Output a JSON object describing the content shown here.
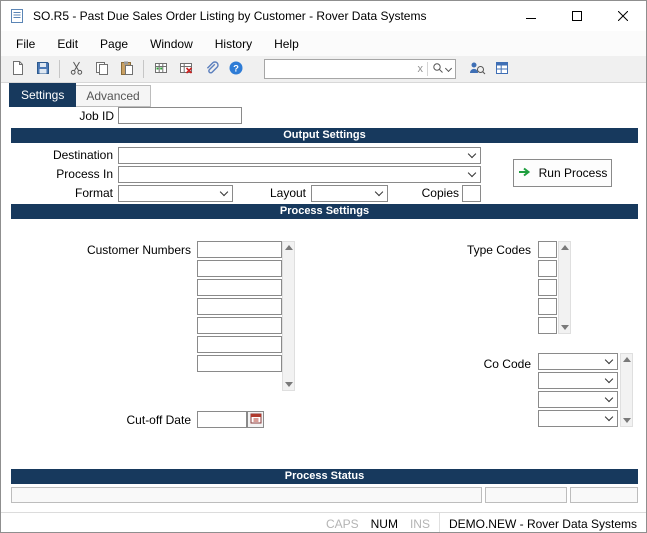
{
  "window": {
    "title": "SO.R5 - Past Due Sales Order Listing by Customer - Rover Data Systems",
    "controls": {
      "minimize": "minimize",
      "maximize": "maximize",
      "close": "close"
    }
  },
  "menu": {
    "items": [
      "File",
      "Edit",
      "Page",
      "Window",
      "History",
      "Help"
    ]
  },
  "toolbar": {
    "search": {
      "value": "",
      "placeholder": ""
    },
    "icons": [
      "new-document-icon",
      "save-icon",
      "cut-icon",
      "copy-icon",
      "paste-icon",
      "grid-insert-icon",
      "grid-delete-icon",
      "attachment-icon",
      "help-icon",
      "clear-search-icon",
      "search-icon",
      "person-search-icon",
      "table-icon"
    ]
  },
  "tabs": {
    "settings": "Settings",
    "advanced": "Advanced"
  },
  "form": {
    "job_id_label": "Job ID",
    "job_id_value": "",
    "sections": {
      "output_settings": "Output Settings",
      "process_settings": "Process Settings",
      "process_status": "Process Status"
    },
    "destination_label": "Destination",
    "process_in_label": "Process In",
    "format_label": "Format",
    "layout_label": "Layout",
    "copies_label": "Copies",
    "copies_value": "",
    "run_process_label": "Run Process",
    "customer_numbers_label": "Customer Numbers",
    "type_codes_label": "Type Codes",
    "co_code_label": "Co Code",
    "cutoff_date_label": "Cut-off Date",
    "cutoff_date_value": ""
  },
  "status_bar": {
    "caps": "CAPS",
    "num": "NUM",
    "ins": "INS",
    "company": "DEMO.NEW - Rover Data Systems"
  },
  "colors": {
    "header_bar": "#17395d",
    "active_tab": "#17395d",
    "run_arrow": "#1e9e3e"
  }
}
